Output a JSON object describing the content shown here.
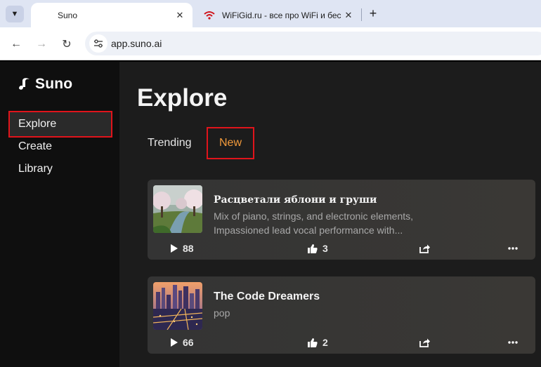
{
  "browser": {
    "tabs": [
      {
        "title": "Suno",
        "active": true,
        "favicon": "blank-icon"
      },
      {
        "title": "WiFiGid.ru - все про WiFi и бес",
        "active": false,
        "favicon": "wifi-icon"
      }
    ],
    "url": "app.suno.ai"
  },
  "sidebar": {
    "logo": "Suno",
    "items": [
      {
        "label": "Explore",
        "selected": true
      },
      {
        "label": "Create",
        "selected": false
      },
      {
        "label": "Library",
        "selected": false
      }
    ]
  },
  "main": {
    "title": "Explore",
    "tabs": [
      {
        "label": "Trending",
        "selected": false
      },
      {
        "label": "New",
        "selected": true
      }
    ],
    "songs": [
      {
        "title": "Расцветали яблони и груши",
        "desc_line1": "Mix of piano, strings, and electronic elements,",
        "desc_line2": "Impassioned lead vocal performance with...",
        "plays": "88",
        "likes": "3",
        "thumb": "blossom-trees-river-image"
      },
      {
        "title": "The Code Dreamers",
        "desc_line1": "pop",
        "plays": "66",
        "likes": "2",
        "thumb": "city-skyline-sunset-image"
      }
    ]
  },
  "colors": {
    "accent_orange": "#f29a3b",
    "highlight_red": "#e0141b",
    "sidebar_bg": "#0f0f0f",
    "main_bg": "#1c1c1c"
  }
}
